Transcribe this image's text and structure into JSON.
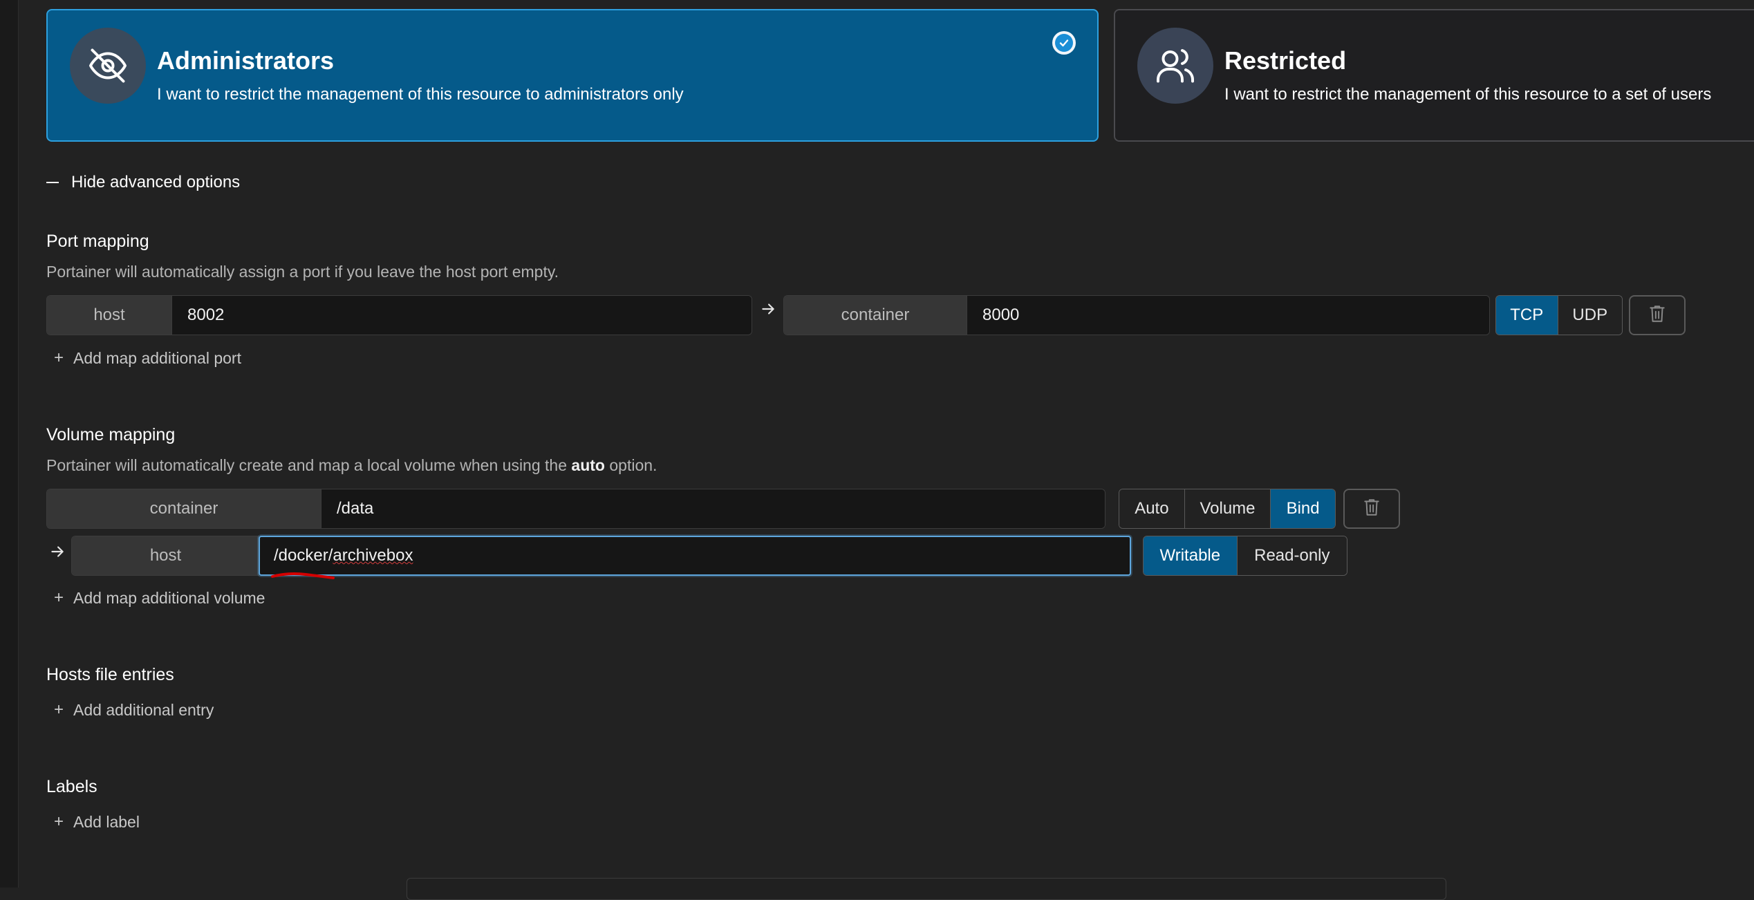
{
  "access": {
    "admin": {
      "title": "Administrators",
      "description": "I want to restrict the management of this resource to administrators only",
      "selected": true,
      "icon": "eye-off-icon"
    },
    "restricted": {
      "title": "Restricted",
      "description": "I want to restrict the management of this resource to a set of users",
      "icon": "users-icon"
    }
  },
  "advanced_toggle": "Hide advanced options",
  "port_mapping": {
    "title": "Port mapping",
    "help": "Portainer will automatically assign a port if you leave the host port empty.",
    "host_label": "host",
    "host_value": "8002",
    "container_label": "container",
    "container_value": "8000",
    "protocols": [
      "TCP",
      "UDP"
    ],
    "active_protocol": "TCP",
    "add_label": "Add map additional port"
  },
  "volume_mapping": {
    "title": "Volume mapping",
    "help_prefix": "Portainer will automatically create and map a local volume when using the ",
    "help_bold": "auto",
    "help_suffix": " option.",
    "container_label": "container",
    "container_value": "/data",
    "types": [
      "Auto",
      "Volume",
      "Bind"
    ],
    "active_type": "Bind",
    "host_label": "host",
    "host_value_prefix": "/docker/",
    "host_value_misspelled": "archivebox",
    "modes": [
      "Writable",
      "Read-only"
    ],
    "active_mode": "Writable",
    "add_label": "Add map additional volume"
  },
  "hosts_file": {
    "title": "Hosts file entries",
    "add_label": "Add additional entry"
  },
  "labels": {
    "title": "Labels",
    "add_label": "Add label"
  },
  "colors": {
    "accent": "#055a8a",
    "accent_border": "#2da0df",
    "background": "#222222"
  }
}
